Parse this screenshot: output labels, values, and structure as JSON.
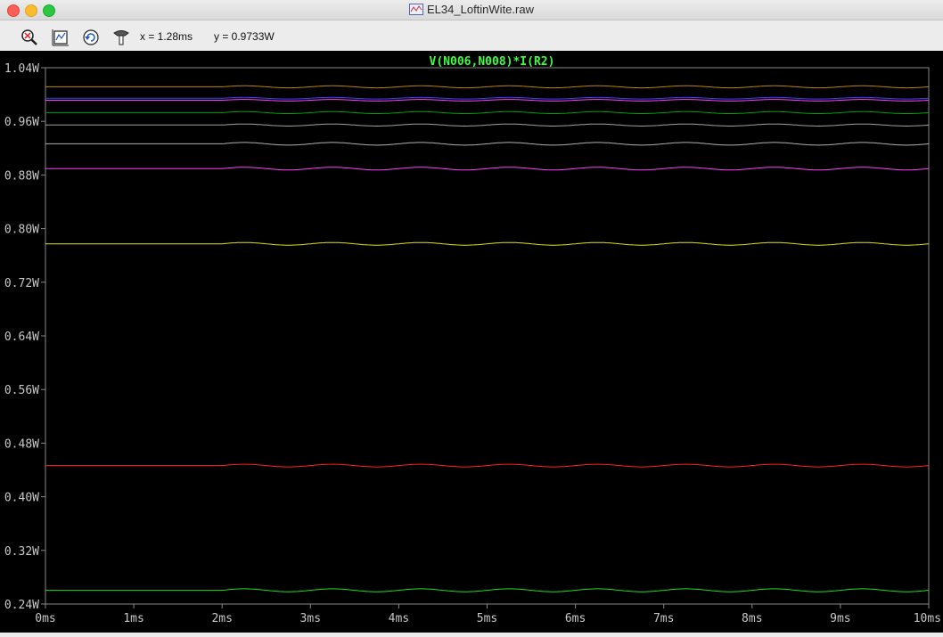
{
  "window": {
    "title": "EL34_LoftinWite.raw"
  },
  "toolbar": {
    "tools": [
      {
        "name": "zoom-icon"
      },
      {
        "name": "autorange-icon"
      },
      {
        "name": "undo-zoom-icon"
      },
      {
        "name": "probe-icon"
      }
    ],
    "cursor_x": "x = 1.28ms",
    "cursor_y": "y = 0.9733W"
  },
  "chart_data": {
    "type": "line",
    "title": "V(N006,N008)*I(R2)",
    "title_color": "#3bff3b",
    "xlabel": "",
    "ylabel": "",
    "xlim": [
      0,
      10
    ],
    "ylim": [
      0.24,
      1.04
    ],
    "x_ticks": [
      "0ms",
      "1ms",
      "2ms",
      "3ms",
      "4ms",
      "5ms",
      "6ms",
      "7ms",
      "8ms",
      "9ms",
      "10ms"
    ],
    "y_ticks": [
      "1.04W",
      "0.96W",
      "0.88W",
      "0.80W",
      "0.72W",
      "0.64W",
      "0.56W",
      "0.48W",
      "0.40W",
      "0.32W",
      "0.24W"
    ],
    "grid": false,
    "series": [
      {
        "color": "#b8860b",
        "base": 1.0115,
        "ripple": 0.0015
      },
      {
        "color": "#4040ff",
        "base": 0.9945,
        "ripple": 0.0012
      },
      {
        "color": "#ff40ff",
        "base": 0.9915,
        "ripple": 0.0012
      },
      {
        "color": "#00a000",
        "base": 0.973,
        "ripple": 0.0015
      },
      {
        "color": "#a0a0a0",
        "base": 0.9545,
        "ripple": 0.0015
      },
      {
        "color": "#b0b0b0",
        "base": 0.9265,
        "ripple": 0.002
      },
      {
        "color": "#ff40ff",
        "base": 0.8895,
        "ripple": 0.002
      },
      {
        "color": "#e0e020",
        "base": 0.7773,
        "ripple": 0.002
      },
      {
        "color": "#ff2020",
        "base": 0.4465,
        "ripple": 0.002
      },
      {
        "color": "#20e020",
        "base": 0.2605,
        "ripple": 0.0022
      }
    ],
    "ripple_period_ms": 1.0,
    "ripple_start_ms": 2.0
  }
}
